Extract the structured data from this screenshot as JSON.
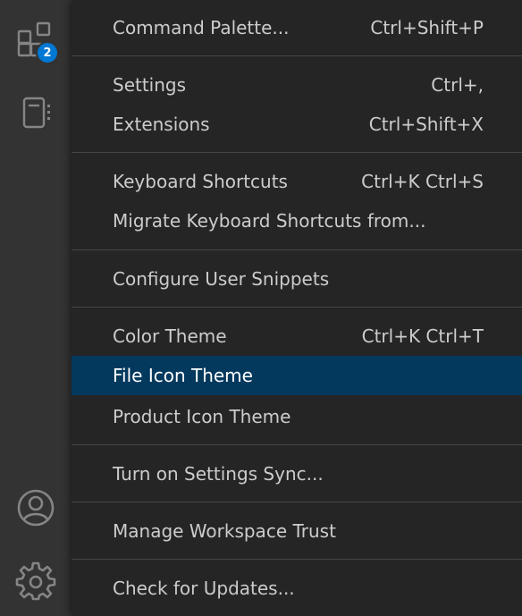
{
  "activity_bar": {
    "extensions_badge": "2"
  },
  "icons": {
    "extensions": "extensions-icon",
    "notebook": "notebook-icon",
    "accounts": "account-icon",
    "manage": "gear-icon"
  },
  "colors": {
    "menu_background": "#252526",
    "activity_bar": "#333333",
    "selection": "#04395e",
    "badge": "#0078d4",
    "text": "#cccccc"
  },
  "menu": {
    "items": [
      {
        "label": "Command Palette...",
        "shortcut": "Ctrl+Shift+P"
      },
      {
        "label": "Settings",
        "shortcut": "Ctrl+,"
      },
      {
        "label": "Extensions",
        "shortcut": "Ctrl+Shift+X"
      },
      {
        "label": "Keyboard Shortcuts",
        "shortcut": "Ctrl+K Ctrl+S"
      },
      {
        "label": "Migrate Keyboard Shortcuts from...",
        "shortcut": ""
      },
      {
        "label": "Configure User Snippets",
        "shortcut": ""
      },
      {
        "label": "Color Theme",
        "shortcut": "Ctrl+K Ctrl+T"
      },
      {
        "label": "File Icon Theme",
        "shortcut": ""
      },
      {
        "label": "Product Icon Theme",
        "shortcut": ""
      },
      {
        "label": "Turn on Settings Sync...",
        "shortcut": ""
      },
      {
        "label": "Manage Workspace Trust",
        "shortcut": ""
      },
      {
        "label": "Check for Updates...",
        "shortcut": ""
      }
    ],
    "selected_item": "File Icon Theme"
  }
}
